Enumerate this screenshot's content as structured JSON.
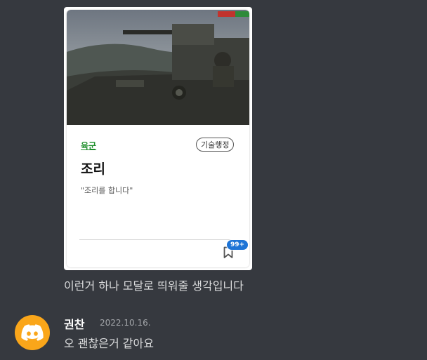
{
  "card": {
    "branch": "육군",
    "tag": "기술행정",
    "title": "조리",
    "description": "\"조리를 합니다\"",
    "badge": "99+",
    "image_icon": "armored-vehicle-photo",
    "bookmark_icon": "bookmark-icon"
  },
  "messages": [
    {
      "text": "이런거 하나 모달로 띄워줄 생각입니다"
    },
    {
      "author": "권찬",
      "timestamp": "2022.10.16.",
      "text": "오 괜찮은거 같아요"
    }
  ],
  "colors": {
    "background": "#36393f",
    "branch_green": "#1f8f2c",
    "badge_blue": "#1d74d6",
    "avatar_orange": "#faa61a"
  }
}
